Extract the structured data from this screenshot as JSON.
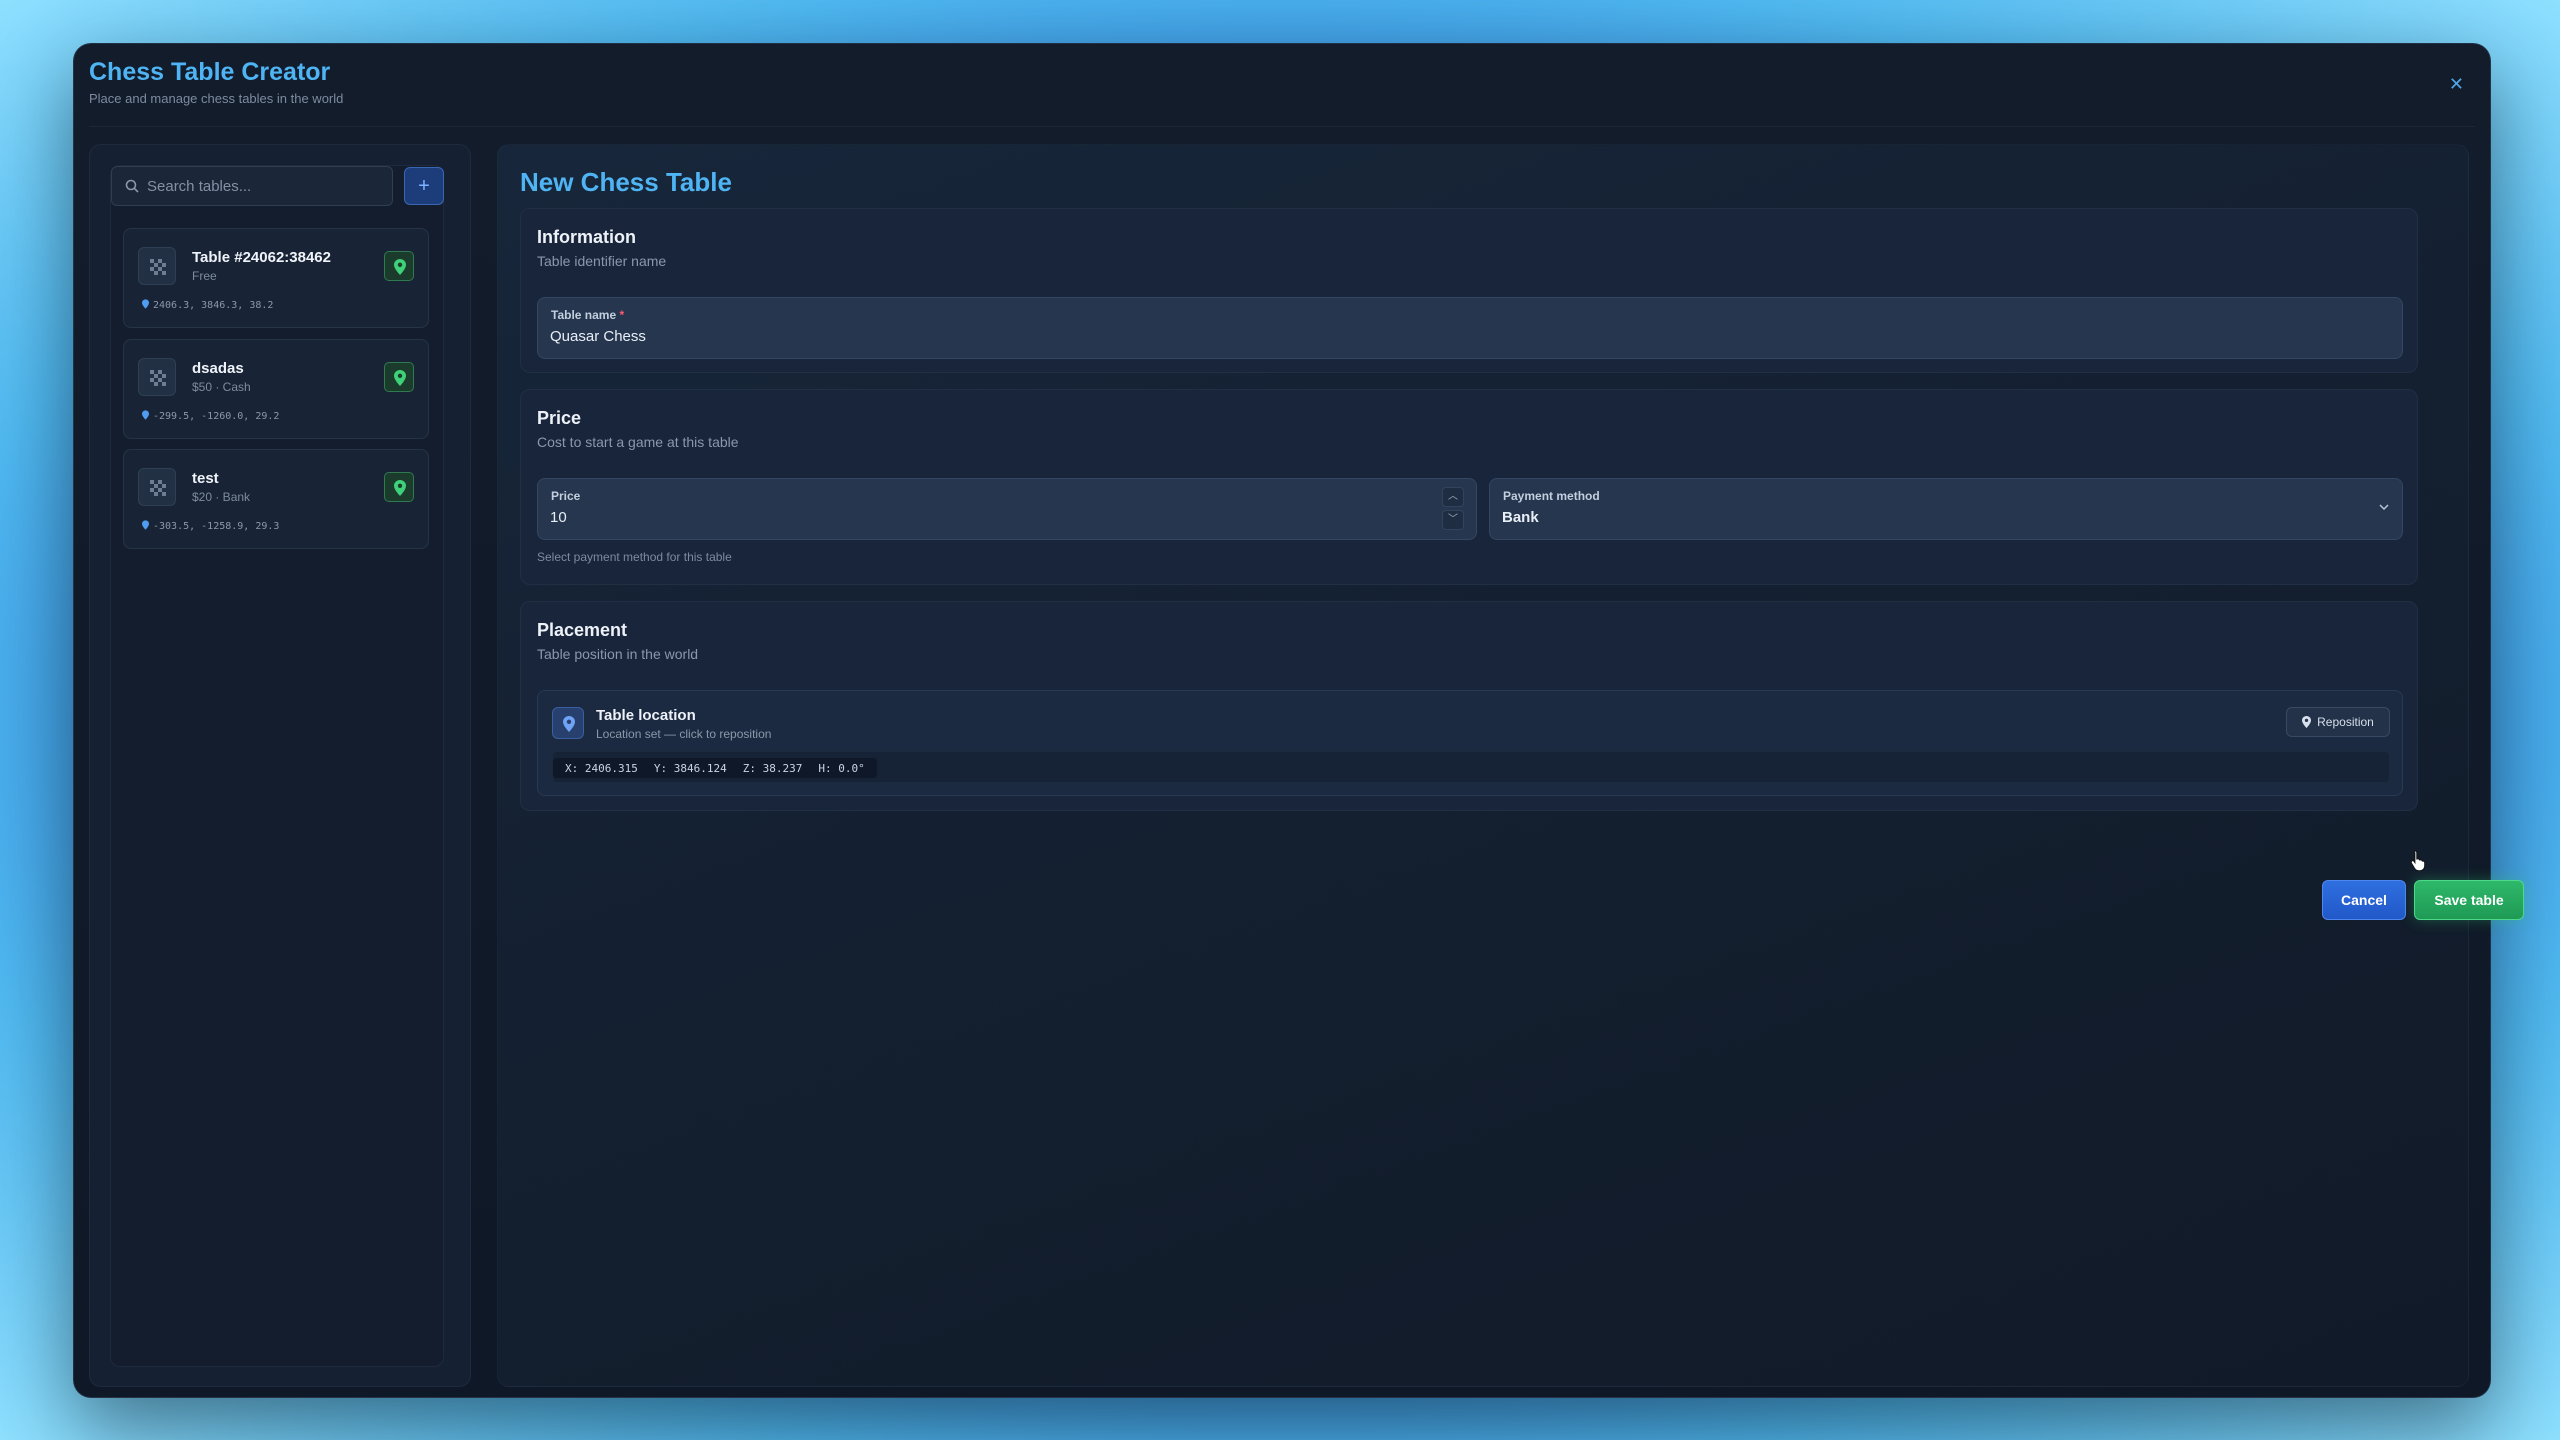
{
  "app": {
    "title": "Chess Table Creator",
    "subtitle": "Place and manage chess tables in the world"
  },
  "sidebar": {
    "search_placeholder": "Search tables...",
    "add_label": "+",
    "tables": [
      {
        "name": "Table #24062:38462",
        "sub": "Free",
        "coords": "2406.3, 3846.3, 38.2"
      },
      {
        "name": "dsadas",
        "sub": "$50 · Cash",
        "coords": "-299.5, -1260.0, 29.2"
      },
      {
        "name": "test",
        "sub": "$20 · Bank",
        "coords": "-303.5, -1258.9, 29.3"
      }
    ]
  },
  "main": {
    "title": "New Chess Table",
    "information": {
      "title": "Information",
      "subtitle": "Table identifier name",
      "name_label": "Table name",
      "name_required": "*",
      "name_value": "Quasar Chess"
    },
    "price": {
      "title": "Price",
      "subtitle": "Cost to start a game at this table",
      "price_label": "Price",
      "price_value": "10",
      "method_label": "Payment method",
      "method_value": "Bank",
      "help": "Select payment method for this table"
    },
    "placement": {
      "title": "Placement",
      "subtitle": "Table position in the world",
      "location_title": "Table location",
      "location_sub": "Location set — click to reposition",
      "reposition_label": "Reposition",
      "coords": {
        "x": "X: 2406.315",
        "y": "Y: 3846.124",
        "z": "Z: 38.237",
        "h": "H: 0.0°"
      }
    },
    "actions": {
      "cancel": "Cancel",
      "save": "Save table"
    }
  },
  "colors": {
    "accent": "#4fb4f4",
    "save_green": "#2eb86a",
    "cancel_blue": "#2f6fe0"
  }
}
